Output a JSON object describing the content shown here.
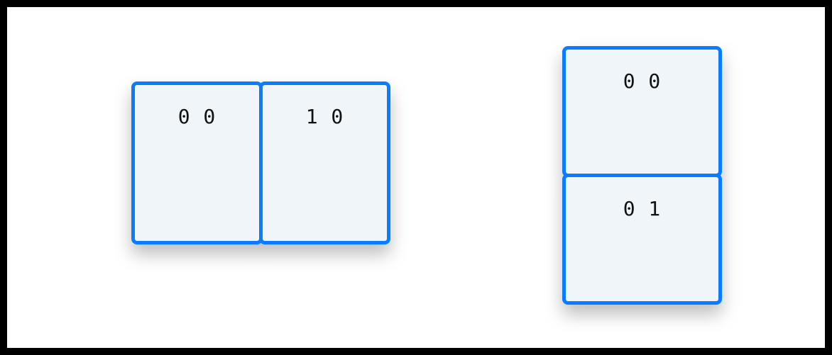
{
  "diagram": {
    "left_group": {
      "orientation": "horizontal",
      "cards": [
        {
          "label": "0 0"
        },
        {
          "label": "1 0"
        }
      ]
    },
    "right_group": {
      "orientation": "vertical",
      "cards": [
        {
          "label": "0 0"
        },
        {
          "label": "0 1"
        }
      ]
    },
    "card_border_color": "#0a7cff",
    "card_fill_color": "#f0f5fa"
  }
}
